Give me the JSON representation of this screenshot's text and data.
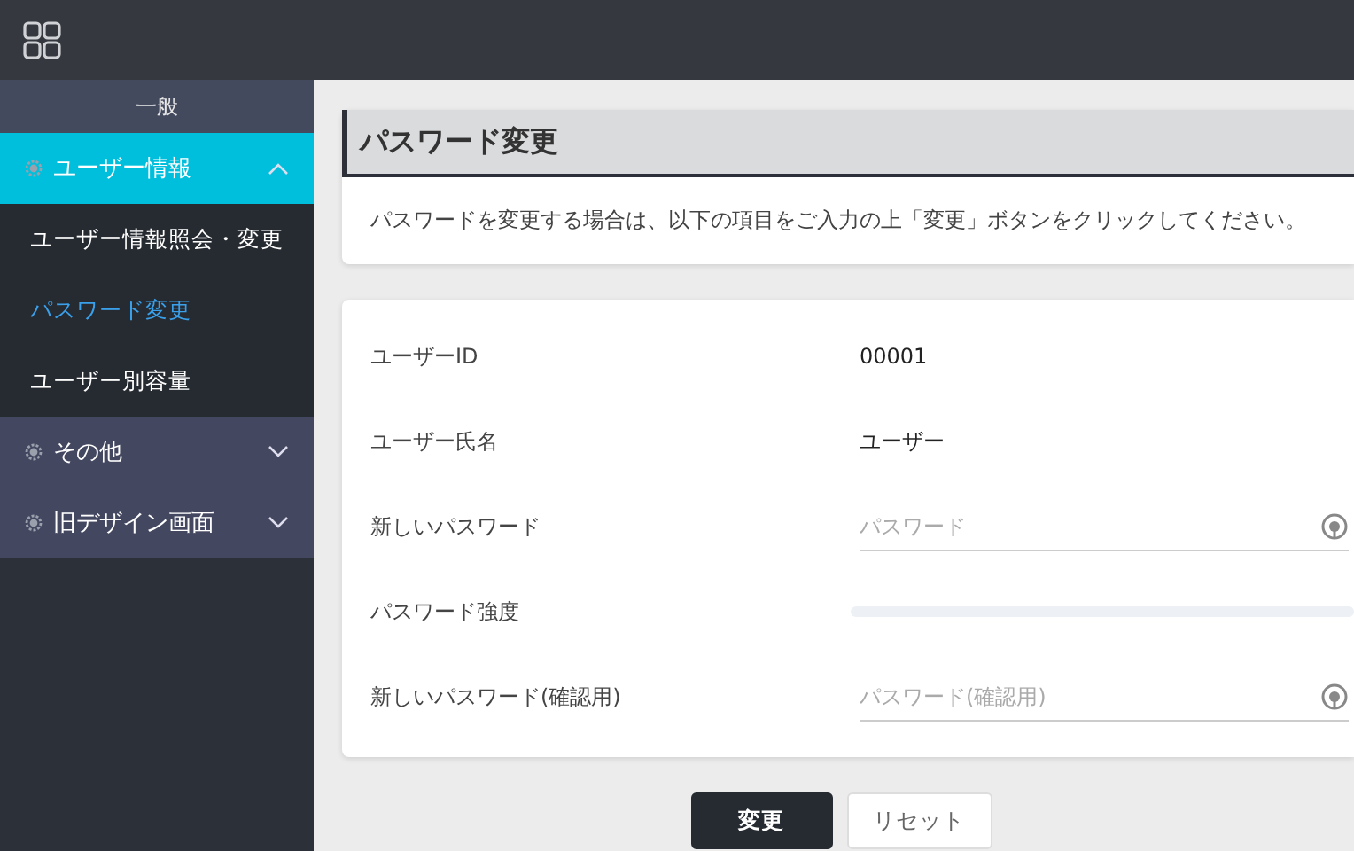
{
  "sidebar": {
    "section": "一般",
    "groups": [
      {
        "label": "ユーザー情報",
        "expanded": true,
        "children": [
          {
            "label": "ユーザー情報照会・変更",
            "selected": false
          },
          {
            "label": "パスワード変更",
            "selected": true
          },
          {
            "label": "ユーザー別容量",
            "selected": false
          }
        ]
      },
      {
        "label": "その他",
        "expanded": false
      },
      {
        "label": "旧デザイン画面",
        "expanded": false
      }
    ]
  },
  "page": {
    "title": "パスワード変更",
    "description": "パスワードを変更する場合は、以下の項目をご入力の上「変更」ボタンをクリックしてください。"
  },
  "form": [
    {
      "kind": "text",
      "label": "ユーザーID",
      "value": "00001"
    },
    {
      "kind": "text",
      "label": "ユーザー氏名",
      "value": "ユーザー"
    },
    {
      "kind": "password",
      "label": "新しいパスワード",
      "placeholder": "パスワード"
    },
    {
      "kind": "meter",
      "label": "パスワード強度",
      "level": 0
    },
    {
      "kind": "password",
      "label": "新しいパスワード(確認用)",
      "placeholder": "パスワード(確認用)"
    }
  ],
  "buttons": [
    {
      "label": "変更",
      "primary": true
    },
    {
      "label": "リセット",
      "primary": false
    }
  ]
}
